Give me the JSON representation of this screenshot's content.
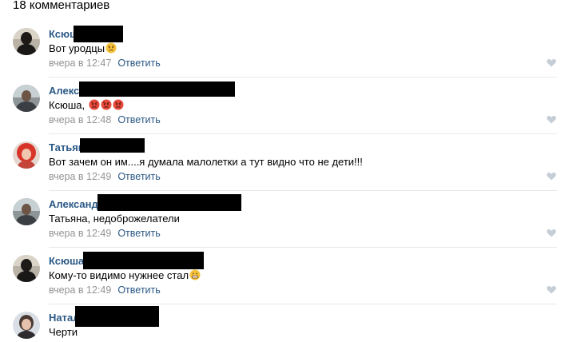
{
  "header": {
    "title": "18 комментариев"
  },
  "comments": [
    {
      "author": "Ксюш",
      "text": "Вот уродцы",
      "emoji": [
        "angry-emoji"
      ],
      "date": "вчера в 12:47",
      "reply": "Ответить",
      "avatar_icon": "user-avatar"
    },
    {
      "author": "Алекса",
      "text": "Ксюша, ",
      "emoji": [
        "rage-emoji",
        "rage-emoji",
        "rage-emoji"
      ],
      "date": "вчера в 12:48",
      "reply": "Ответить",
      "avatar_icon": "user-avatar"
    },
    {
      "author": "Татьян",
      "text": "Вот зачем он им....я думала малолетки а тут видно что не дети!!!",
      "emoji": [],
      "date": "вчера в 12:49",
      "reply": "Ответить",
      "avatar_icon": "user-avatar"
    },
    {
      "author": "Александр",
      "text": "Татьяна, недоброжелатели",
      "emoji": [],
      "date": "вчера в 12:49",
      "reply": "Ответить",
      "avatar_icon": "user-avatar"
    },
    {
      "author": "Ксюша",
      "text": "Кому-то видимо нужнее стал",
      "emoji": [
        "grin-emoji"
      ],
      "date": "вчера в 12:49",
      "reply": "Ответить",
      "avatar_icon": "user-avatar"
    },
    {
      "author": "Натал",
      "text": "Черти",
      "emoji": [],
      "date": "",
      "reply": "",
      "avatar_icon": "user-avatar"
    }
  ],
  "like_icon": "heart-icon",
  "colors": {
    "link": "#2a5885",
    "meta": "#939393",
    "divider": "#e7e8ec",
    "heart": "#c5cdd6"
  }
}
